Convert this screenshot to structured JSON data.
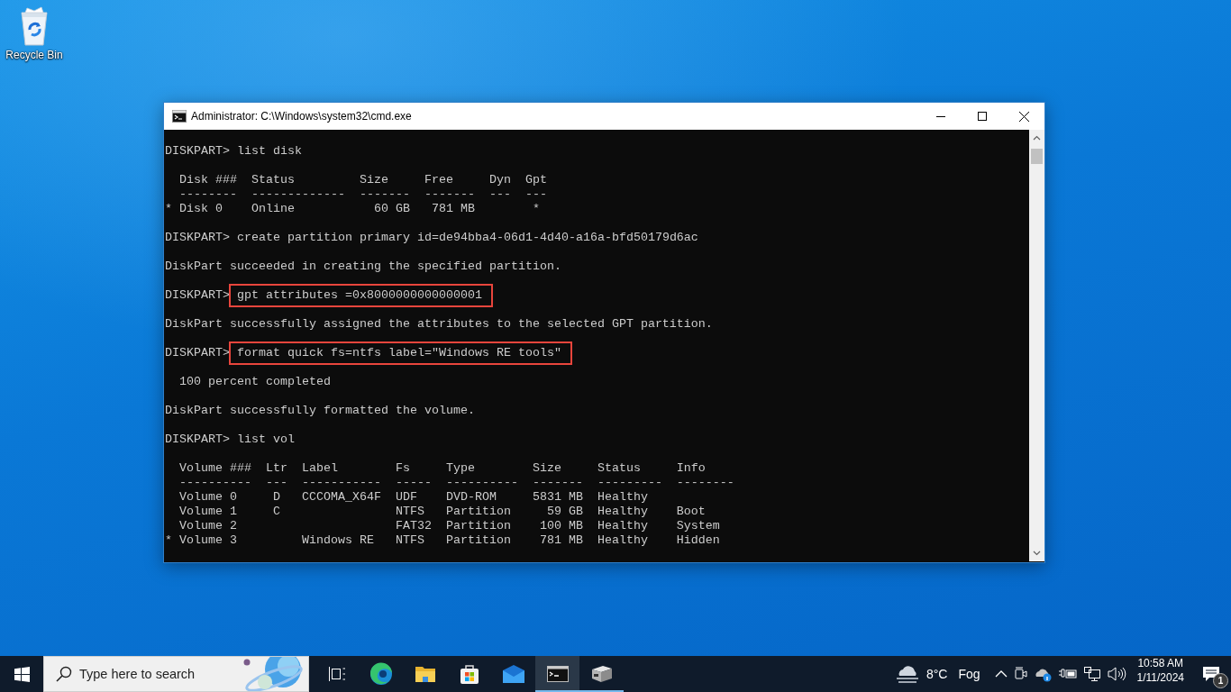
{
  "desktop": {
    "icons": [
      {
        "label": "Recycle Bin"
      }
    ]
  },
  "window": {
    "title": "Administrator: C:\\Windows\\system32\\cmd.exe",
    "console": {
      "blocks": [
        {
          "lines": [
            {
              "kind": "prompt",
              "prompt": "DISKPART>",
              "command": "list disk",
              "highlighted": false
            }
          ]
        },
        {
          "lines": [
            {
              "kind": "output",
              "text": "  Disk ###  Status         Size     Free     Dyn  Gpt"
            },
            {
              "kind": "output",
              "text": "  --------  -------------  -------  -------  ---  ---"
            },
            {
              "kind": "output",
              "text": "* Disk 0    Online           60 GB   781 MB        *"
            }
          ]
        },
        {
          "lines": [
            {
              "kind": "prompt",
              "prompt": "DISKPART>",
              "command": "create partition primary id=de94bba4-06d1-4d40-a16a-bfd50179d6ac",
              "highlighted": false
            }
          ]
        },
        {
          "lines": [
            {
              "kind": "output",
              "text": "DiskPart succeeded in creating the specified partition."
            }
          ]
        },
        {
          "lines": [
            {
              "kind": "prompt",
              "prompt": "DISKPART>",
              "command": "gpt attributes =0x8000000000000001",
              "highlighted": true
            }
          ]
        },
        {
          "lines": [
            {
              "kind": "output",
              "text": "DiskPart successfully assigned the attributes to the selected GPT partition."
            }
          ]
        },
        {
          "lines": [
            {
              "kind": "prompt",
              "prompt": "DISKPART>",
              "command": "format quick fs=ntfs label=\"Windows RE tools\"",
              "highlighted": true
            }
          ]
        },
        {
          "lines": [
            {
              "kind": "output",
              "text": "  100 percent completed"
            }
          ]
        },
        {
          "lines": [
            {
              "kind": "output",
              "text": "DiskPart successfully formatted the volume."
            }
          ]
        },
        {
          "lines": [
            {
              "kind": "prompt",
              "prompt": "DISKPART>",
              "command": "list vol",
              "highlighted": false
            }
          ]
        },
        {
          "lines": [
            {
              "kind": "output",
              "text": "  Volume ###  Ltr  Label        Fs     Type        Size     Status     Info"
            },
            {
              "kind": "output",
              "text": "  ----------  ---  -----------  -----  ----------  -------  ---------  --------"
            },
            {
              "kind": "output",
              "text": "  Volume 0     D   CCCOMA_X64F  UDF    DVD-ROM     5831 MB  Healthy"
            },
            {
              "kind": "output",
              "text": "  Volume 1     C                NTFS   Partition     59 GB  Healthy    Boot"
            },
            {
              "kind": "output",
              "text": "  Volume 2                      FAT32  Partition    100 MB  Healthy    System"
            },
            {
              "kind": "output",
              "text": "* Volume 3         Windows RE   NTFS   Partition    781 MB  Healthy    Hidden"
            }
          ]
        }
      ]
    }
  },
  "taskbar": {
    "search": {
      "placeholder": "Type here to search"
    },
    "apps": [
      {
        "kind": "task-view",
        "selected": false,
        "running": false
      },
      {
        "kind": "edge",
        "selected": false,
        "running": false
      },
      {
        "kind": "folder",
        "selected": false,
        "running": false
      },
      {
        "kind": "store",
        "selected": false,
        "running": false
      },
      {
        "kind": "mail",
        "selected": false,
        "running": false
      },
      {
        "kind": "terminal",
        "selected": true,
        "running": true
      },
      {
        "kind": "drive",
        "selected": false,
        "running": true
      }
    ],
    "weather": {
      "temperature": "8°C",
      "condition": "Fog"
    },
    "clock": {
      "time": "10:58 AM",
      "date": "1/11/2024"
    },
    "notifications": {
      "count": "1"
    }
  }
}
